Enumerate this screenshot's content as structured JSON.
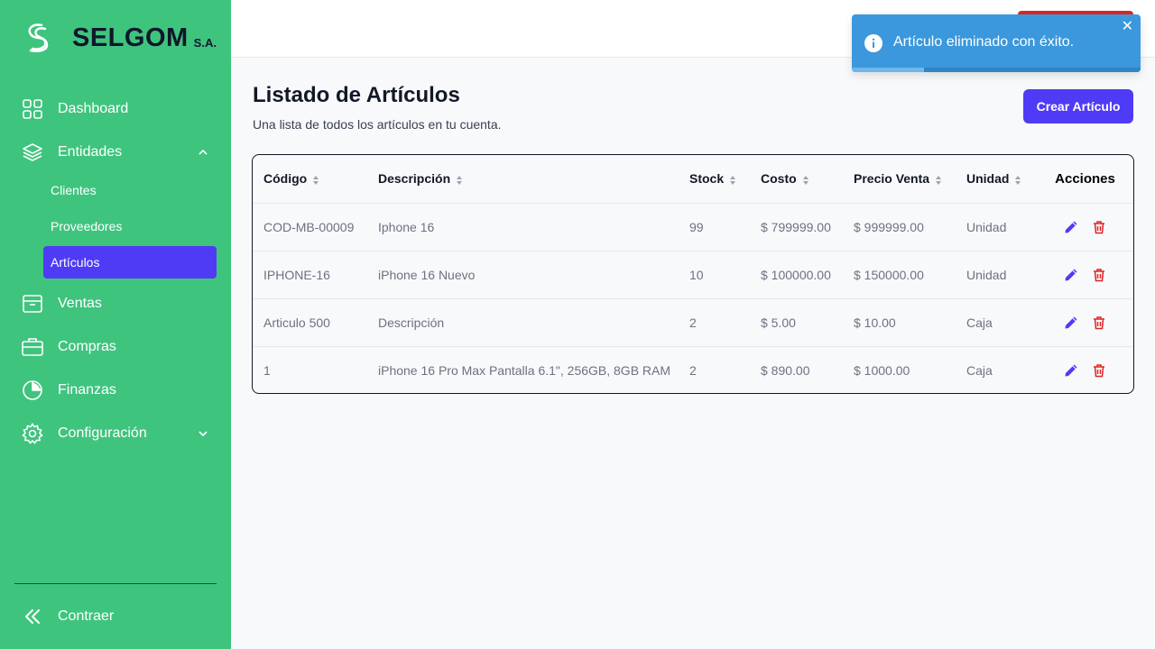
{
  "brand": {
    "name": "SELGOM",
    "suffix": "S.A."
  },
  "sidebar": {
    "items": [
      {
        "label": "Dashboard",
        "icon": "grid-icon"
      },
      {
        "label": "Entidades",
        "icon": "layers-icon",
        "expanded": true
      },
      {
        "label": "Ventas",
        "icon": "archive-box-icon"
      },
      {
        "label": "Compras",
        "icon": "briefcase-icon"
      },
      {
        "label": "Finanzas",
        "icon": "pie-chart-icon"
      },
      {
        "label": "Configuración",
        "icon": "gear-icon",
        "expanded": false
      }
    ],
    "subitems": [
      {
        "label": "Clientes"
      },
      {
        "label": "Proveedores"
      },
      {
        "label": "Artículos",
        "active": true
      }
    ],
    "collapse_label": "Contraer"
  },
  "page": {
    "title": "Listado de Artículos",
    "subtitle": "Una lista de todos los artículos en tu cuenta.",
    "create_button": "Crear Artículo"
  },
  "table": {
    "headers": [
      "Código",
      "Descripción",
      "Stock",
      "Costo",
      "Precio Venta",
      "Unidad",
      "Acciones"
    ],
    "rows": [
      [
        "COD-MB-00009",
        "Iphone 16",
        "99",
        "$ 799999.00",
        "$ 999999.00",
        "Unidad"
      ],
      [
        "IPHONE-16",
        "iPhone 16 Nuevo",
        "10",
        "$ 100000.00",
        "$ 150000.00",
        "Unidad"
      ],
      [
        "Articulo 500",
        "Descripción",
        "2",
        "$ 5.00",
        "$ 10.00",
        "Caja"
      ],
      [
        "1",
        "iPhone 16 Pro Max Pantalla 6.1\", 256GB, 8GB RAM",
        "2",
        "$ 890.00",
        "$ 1000.00",
        "Caja"
      ]
    ]
  },
  "toast": {
    "message": "Artículo eliminado con éxito.",
    "progress": 0.25
  },
  "colors": {
    "sidebar": "#3fc47e",
    "accent": "#4f3bf5",
    "danger": "#dc2626",
    "toast": "#3b98dc"
  }
}
